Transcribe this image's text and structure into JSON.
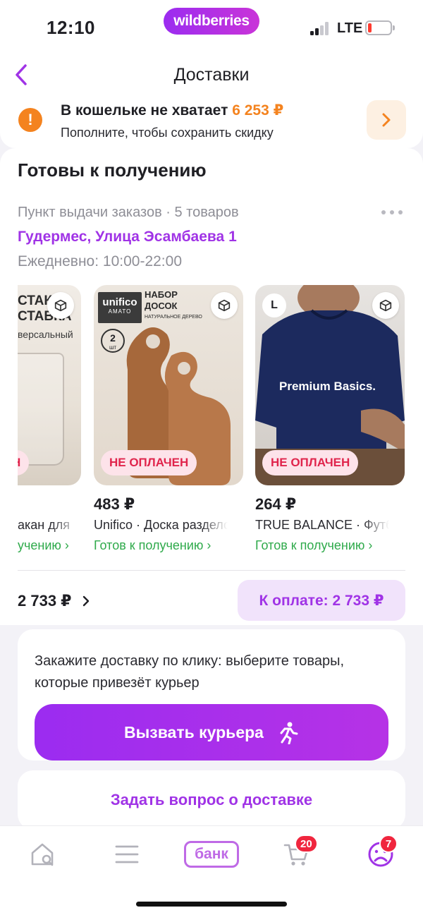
{
  "status_bar": {
    "time": "12:10",
    "brand": "wildberries",
    "network": "LTE"
  },
  "header": {
    "title": "Доставки"
  },
  "wallet_alert": {
    "title": "В кошельке не хватает",
    "amount": "6 253 ₽",
    "subtitle": "Пополните, чтобы сохранить скидку"
  },
  "pickup": {
    "section_title": "Готовы к получению",
    "meta": "Пункт выдачи заказов · 5 товаров",
    "address": "Гудермес, Улица Эсамбаева 1",
    "hours": "Ежедневно: 10:00-22:00"
  },
  "products": [
    {
      "image_text_1": "СТАК",
      "image_text_2": "СТАВКА",
      "image_text_3": "версальный",
      "badge": "Н",
      "name": "акан для",
      "status": "учению ›"
    },
    {
      "image_text_1": "НАБОР",
      "image_text_2": "ДОСОК",
      "image_text_3": "НАТУРАЛЬНОЕ ДЕРЕВО",
      "logo": "unifico",
      "logo_sub": "AMATO",
      "count": "2",
      "count_unit": "шт",
      "badge": "НЕ ОПЛАЧЕН",
      "price": "483 ₽",
      "name": "Unifico · Доска разделочная",
      "status": "Готов к получению ›"
    },
    {
      "size": "L",
      "image_text_1": "Premium Basics.",
      "badge": "НЕ ОПЛАЧЕН",
      "price": "264 ₽",
      "name": "TRUE BALANCE · Футболка",
      "status": "Готов к получению ›"
    }
  ],
  "totals": {
    "total": "2 733 ₽",
    "pay_button": "К оплате: 2 733 ₽"
  },
  "courier": {
    "text": "Закажите доставку по клику: выберите товары, которые привезёт курьер",
    "button": "Вызвать курьера"
  },
  "ask_button": "Задать вопрос о доставке",
  "tabbar": {
    "bank_label": "банк",
    "cart_count": "20",
    "profile_count": "7"
  },
  "colors": {
    "accent": "#a033e6",
    "warning": "#f4831f",
    "unpaid": "#e0244c",
    "ready": "#2faa4b"
  }
}
